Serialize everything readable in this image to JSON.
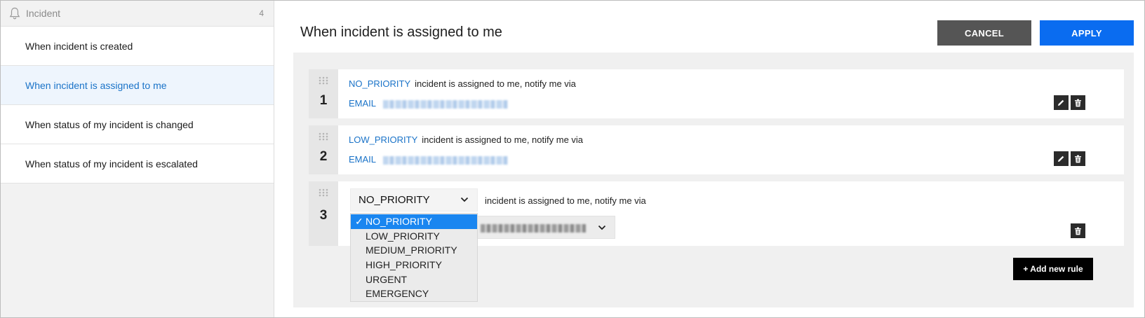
{
  "sidebar": {
    "header": {
      "title": "Incident",
      "count": "4",
      "icon": "bell-icon"
    },
    "items": [
      {
        "label": "When incident is created"
      },
      {
        "label": "When incident is assigned to me",
        "active": true
      },
      {
        "label": "When status of my incident is changed"
      },
      {
        "label": "When status of my incident is escalated"
      }
    ]
  },
  "main": {
    "title": "When incident is assigned to me",
    "buttons": {
      "cancel": "CANCEL",
      "apply": "APPLY"
    },
    "rules": [
      {
        "number": "1",
        "priority": "NO_PRIORITY",
        "text": "incident is assigned to me, notify me via",
        "channel": "EMAIL"
      },
      {
        "number": "2",
        "priority": "LOW_PRIORITY",
        "text": "incident is assigned to me, notify me via",
        "channel": "EMAIL"
      },
      {
        "number": "3",
        "priority_select": "NO_PRIORITY",
        "text": "incident is assigned to me, notify me via",
        "dropdown_options": [
          "NO_PRIORITY",
          "LOW_PRIORITY",
          "MEDIUM_PRIORITY",
          "HIGH_PRIORITY",
          "URGENT",
          "EMERGENCY"
        ],
        "check_mark": "✓"
      }
    ],
    "add_rule": "+ Add new rule"
  },
  "colors": {
    "accent": "#1a73c8",
    "apply": "#0a6cf0",
    "cancel": "#555555",
    "selected": "#1a86f0"
  }
}
